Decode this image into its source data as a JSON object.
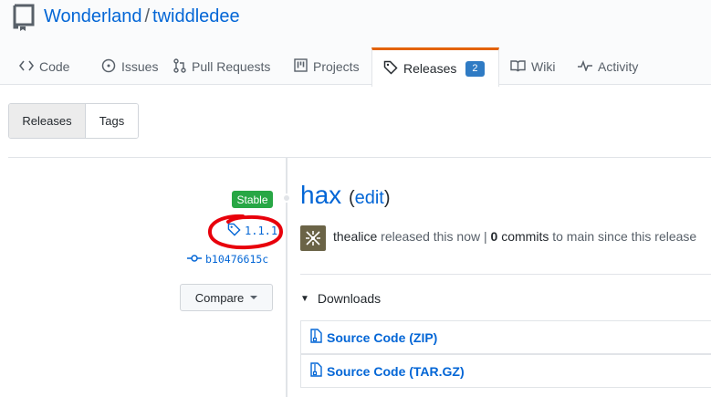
{
  "repo": {
    "owner": "Wonderland",
    "separator": "/",
    "name": "twiddledee"
  },
  "tabs": [
    {
      "label": "Code",
      "icon": "code-icon"
    },
    {
      "label": "Issues",
      "icon": "issue-icon"
    },
    {
      "label": "Pull Requests",
      "icon": "pull-request-icon"
    },
    {
      "label": "Projects",
      "icon": "project-icon"
    },
    {
      "label": "Releases",
      "icon": "tag-icon",
      "counter": "2",
      "selected": true
    },
    {
      "label": "Wiki",
      "icon": "book-icon"
    },
    {
      "label": "Activity",
      "icon": "pulse-icon"
    }
  ],
  "subnav": {
    "releases": "Releases",
    "tags": "Tags"
  },
  "release": {
    "badge": "Stable",
    "tag": "1.1.1",
    "commit": "b10476615c",
    "compare_label": "Compare",
    "title": "hax",
    "edit_label": "edit",
    "author": "thealice",
    "released_text": "released this now |",
    "commits_count": "0",
    "commits_label": "commits",
    "to_main_text": "to main",
    "since_text": "since this release"
  },
  "downloads": {
    "label": "Downloads",
    "assets": [
      {
        "label": "Source Code (ZIP)"
      },
      {
        "label": "Source Code (TAR.GZ)"
      }
    ]
  },
  "colors": {
    "accent": "#0366d6",
    "stable": "#28a745",
    "counter": "#2f7bc4",
    "annotation": "#e8000b"
  }
}
